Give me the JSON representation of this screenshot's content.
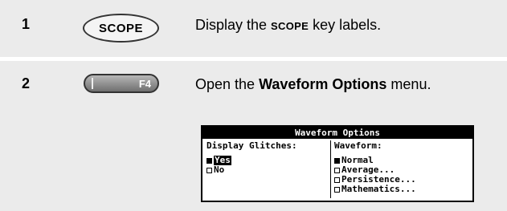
{
  "steps": [
    {
      "number": "1",
      "key_label": "SCOPE",
      "text_before": "Display the ",
      "text_key": "SCOPE",
      "text_after": " key labels."
    },
    {
      "number": "2",
      "key_label": "F4",
      "text_before": "Open the ",
      "text_bold": "Waveform Options",
      "text_after": " menu."
    }
  ],
  "menu": {
    "title": "Waveform Options",
    "left_header": "Display Glitches:",
    "left_options": [
      {
        "label": "Yes",
        "selected": true,
        "highlighted": true
      },
      {
        "label": "No",
        "selected": false,
        "highlighted": false
      }
    ],
    "right_header": "Waveform:",
    "right_options": [
      {
        "label": "Normal",
        "selected": true
      },
      {
        "label": "Average...",
        "selected": false
      },
      {
        "label": "Persistence...",
        "selected": false
      },
      {
        "label": "Mathematics...",
        "selected": false
      }
    ]
  }
}
